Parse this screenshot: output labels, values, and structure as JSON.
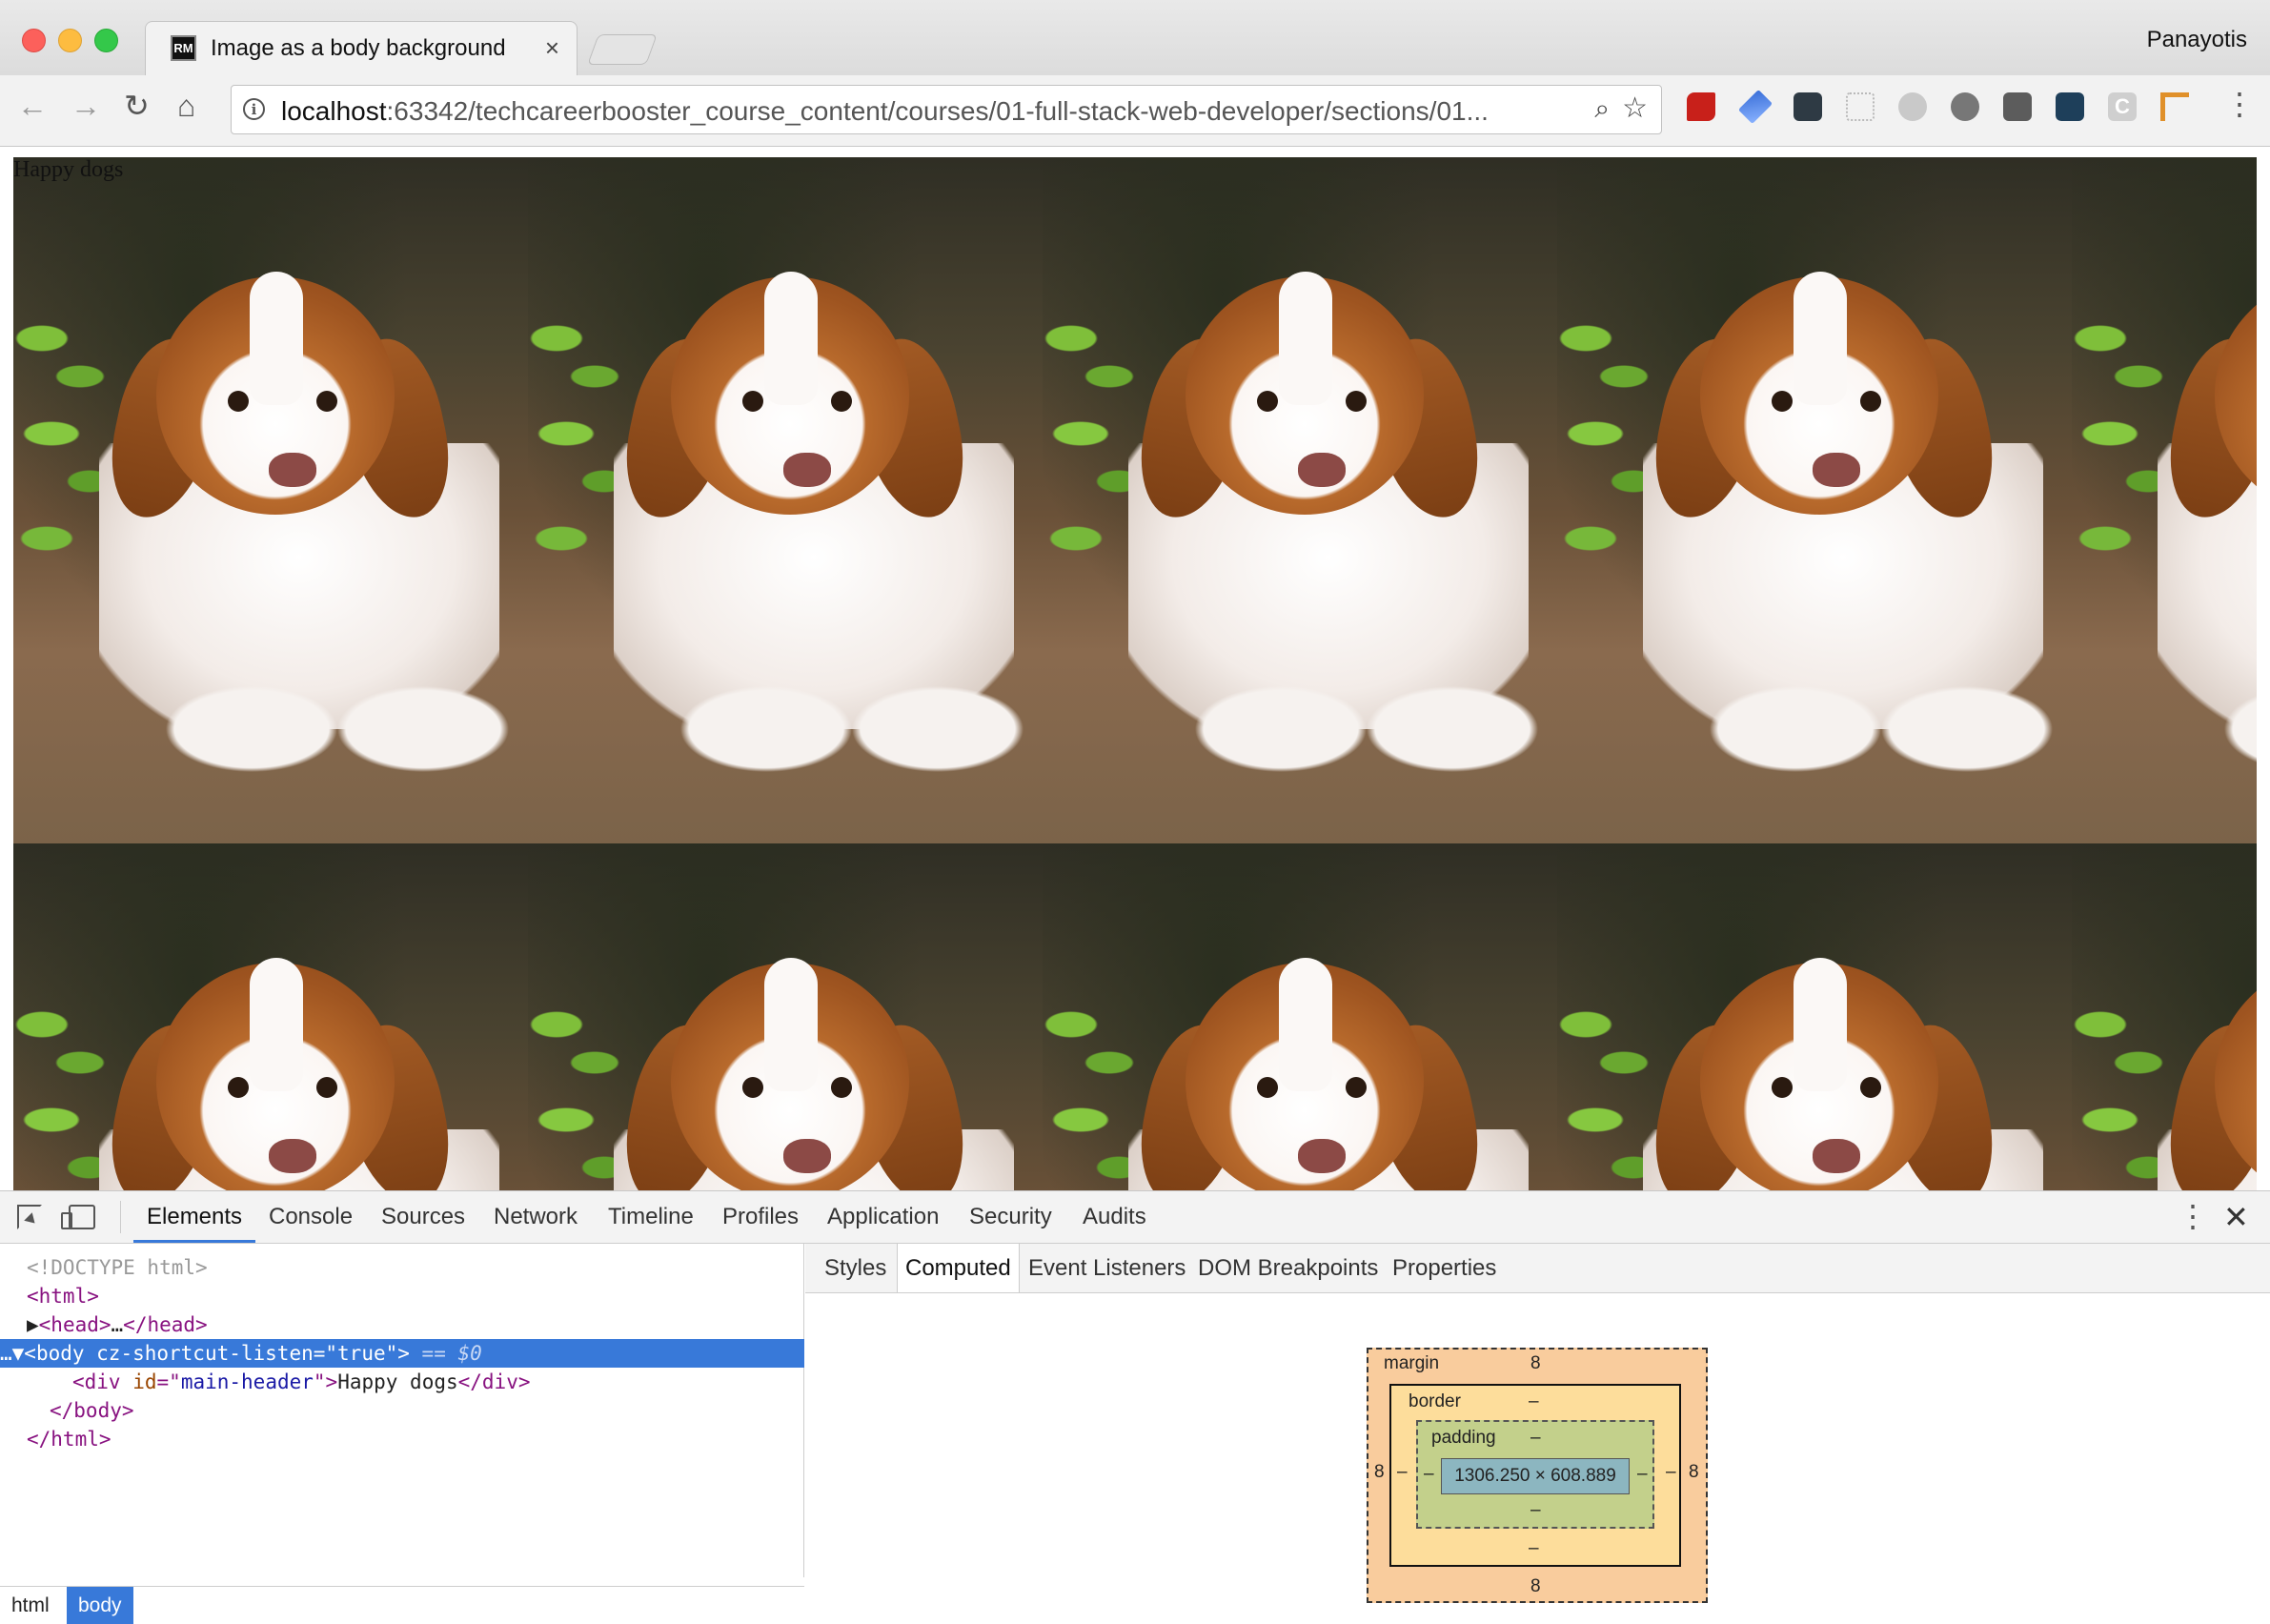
{
  "browser": {
    "tab": {
      "favicon": "RM",
      "title": "Image as a body background",
      "close_icon": "×"
    },
    "profile_name": "Panayotis",
    "address": {
      "host": "localhost",
      "rest": ":63342/techcareerbooster_course_content/courses/01-full-stack-web-developer/sections/01..."
    },
    "nav_icons": {
      "back": "←",
      "forward": "→",
      "reload": "↻",
      "home": "⌂",
      "zoom": "⌕",
      "star": "☆",
      "menu": "⋮"
    },
    "extensions": [
      "lastpass-icon",
      "eyedropper-icon",
      "evernote-icon",
      "tree-icon",
      "skype-icon",
      "settings-ext-icon",
      "dark-ext-icon",
      "ghostery-icon",
      "c-ext-icon",
      "ruler-icon"
    ]
  },
  "page": {
    "header_text": "Happy dogs"
  },
  "devtools": {
    "tabs": [
      "Elements",
      "Console",
      "Sources",
      "Network",
      "Timeline",
      "Profiles",
      "Application",
      "Security",
      "Audits"
    ],
    "active_tab": "Elements",
    "dom": {
      "doctype": "<!DOCTYPE html>",
      "html_open": "<html>",
      "head": {
        "tag_open": "<head>",
        "ellipsis": "…",
        "tag_close": "</head>"
      },
      "body": {
        "prefix": "…▼",
        "tag": "<body",
        "attr": " cz-shortcut-listen",
        "eq": "=\"",
        "value": "true",
        "close": "\">",
        "marker": " == $0"
      },
      "div": {
        "tag": "<div",
        "attr": " id",
        "eq": "=\"",
        "value": "main-header",
        "close": "\">",
        "text": "Happy dogs",
        "end": "</div>"
      },
      "body_close": "</body>",
      "html_close": "</html>"
    },
    "breadcrumbs": [
      "html",
      "body"
    ],
    "side_tabs": [
      "Styles",
      "Computed",
      "Event Listeners",
      "DOM Breakpoints",
      "Properties"
    ],
    "active_side_tab": "Computed",
    "box_model": {
      "margin_label": "margin",
      "margin_top": "8",
      "margin_left": "8",
      "margin_right": "8",
      "margin_bottom": "8",
      "border_label": "border",
      "border_top": "–",
      "border_left": "–",
      "border_right": "–",
      "border_bottom": "–",
      "padding_label": "padding",
      "padding_top": "–",
      "padding_left": "–",
      "padding_right": "–",
      "padding_bottom": "–",
      "content": "1306.250 × 608.889"
    },
    "menu_icon": "⋮",
    "close_icon": "✕"
  }
}
